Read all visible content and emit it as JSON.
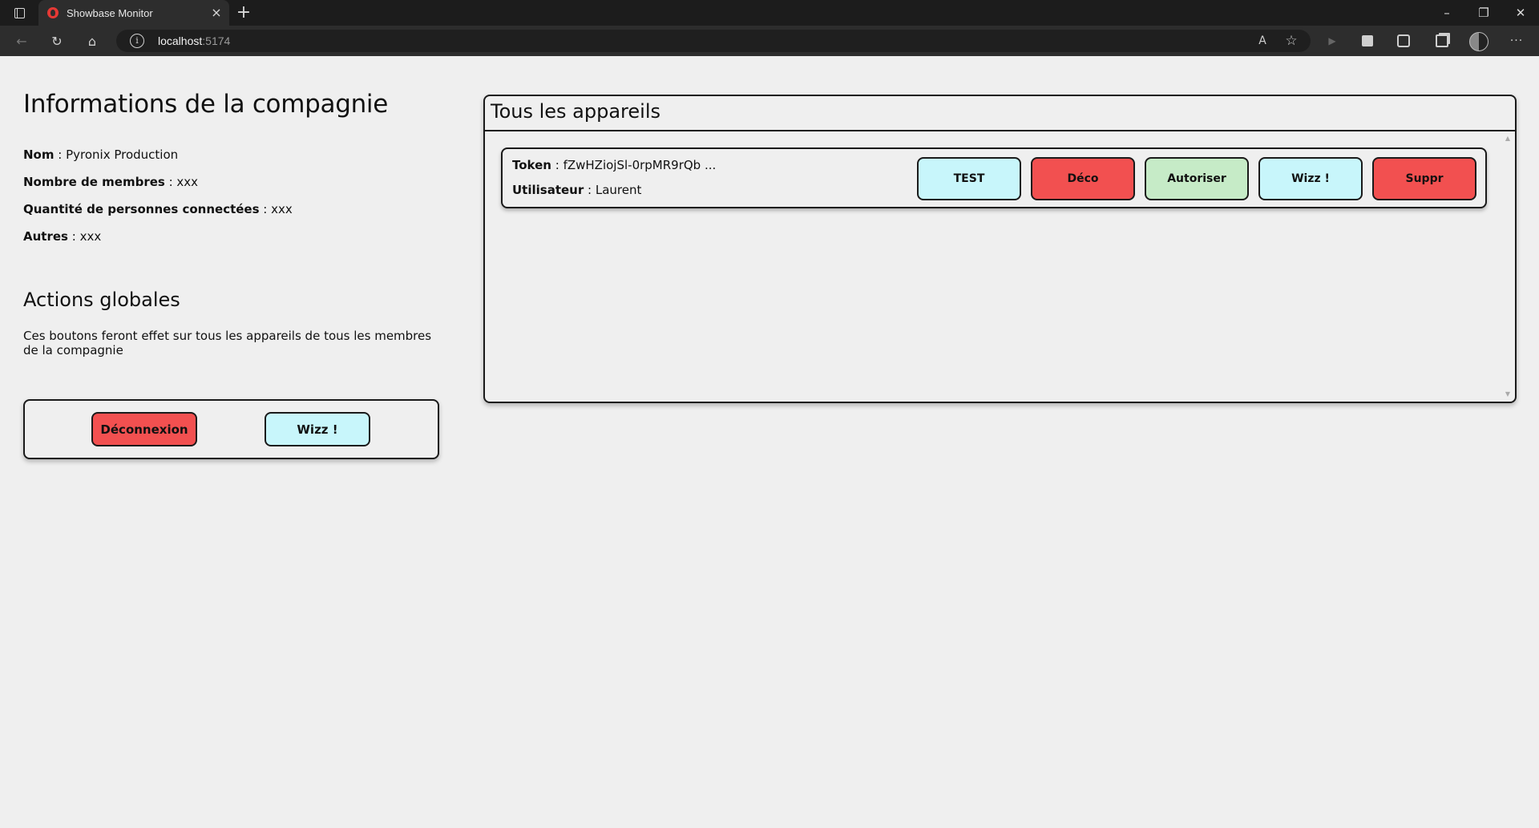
{
  "browser": {
    "tab_title": "Showbase Monitor",
    "tab_close": "×",
    "new_tab": "+",
    "url_host": "localhost",
    "url_port": ":5174",
    "window_controls": {
      "minimize": "–",
      "restore": "❐",
      "close": "✕"
    },
    "nav": {
      "back": "←",
      "reload": "↻",
      "home": "⌂",
      "info": "i"
    },
    "toolbar_icons": {
      "read_aloud": "A",
      "favorites": "☆",
      "play": "▶",
      "menu": "···"
    }
  },
  "company": {
    "title": "Informations de la compagnie",
    "fields": [
      {
        "label": "Nom",
        "sep": " : ",
        "value": "Pyronix Production"
      },
      {
        "label": "Nombre de membres",
        "sep": " : ",
        "value": "xxx"
      },
      {
        "label": "Quantité de personnes connectées",
        "sep": " : ",
        "value": "xxx"
      },
      {
        "label": "Autres",
        "sep": " : ",
        "value": "xxx"
      }
    ]
  },
  "global_actions": {
    "title": "Actions globales",
    "description": "Ces boutons feront effet sur tous les appareils de tous les membres de la compagnie",
    "disconnect_label": "Déconnexion",
    "wizz_label": "Wizz !"
  },
  "devices": {
    "title": "Tous les appareils",
    "items": [
      {
        "token_label": "Token",
        "token_value": "fZwHZiojSl-0rpMR9rQb ...",
        "user_label": "Utilisateur",
        "user_value": "Laurent",
        "buttons": {
          "test": "TEST",
          "deco": "Déco",
          "authorize": "Autoriser",
          "wizz": "Wizz !",
          "delete": "Suppr"
        }
      }
    ]
  },
  "colors": {
    "red": "#f25050",
    "cyan": "#c8f6fb",
    "green": "#c6ebc7",
    "page_bg": "#efefef"
  }
}
